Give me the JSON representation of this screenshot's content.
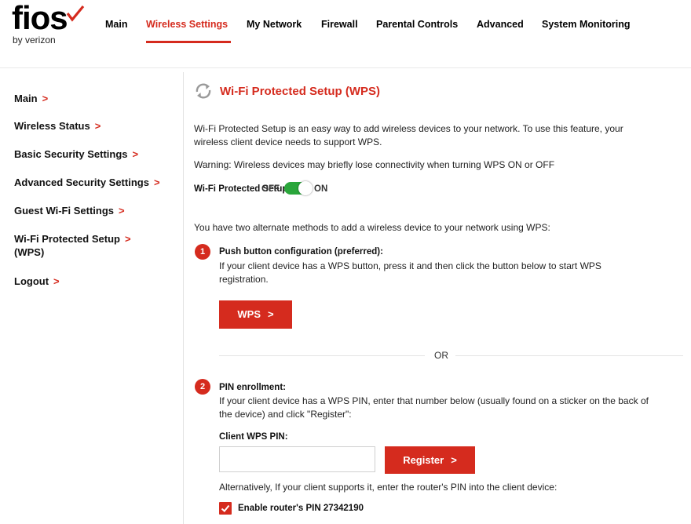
{
  "brand": {
    "logo": "fios",
    "sub": "by verizon",
    "accent": "#d52b1e"
  },
  "nav": {
    "main": "Main",
    "wireless": "Wireless Settings",
    "network": "My Network",
    "firewall": "Firewall",
    "parental": "Parental Controls",
    "advanced": "Advanced",
    "monitoring": "System Monitoring",
    "active": "Wireless Settings"
  },
  "sidebar": {
    "items": [
      {
        "label": "Main"
      },
      {
        "label": "Wireless Status"
      },
      {
        "label": "Basic Security Settings"
      },
      {
        "label": "Advanced Security Settings"
      },
      {
        "label": "Guest Wi-Fi Settings"
      },
      {
        "label_line1": "Wi-Fi Protected Setup",
        "label_line2": "(WPS)"
      },
      {
        "label": "Logout"
      }
    ]
  },
  "main": {
    "title": "Wi-Fi Protected Setup (WPS)",
    "intro_line1": "Wi-Fi Protected Setup is an easy way to add wireless devices to your network. To use this feature, your",
    "intro_line2": "wireless client device needs to support WPS.",
    "warning": "Warning: Wireless devices may briefly lose connectivity when turning WPS ON or OFF",
    "wps_label": "Wi-Fi Protected Setup:",
    "toggle_off": "OFF",
    "toggle_on": "ON",
    "toggle_state": "ON",
    "methods_text": "You have two alternate methods to add a wireless device to your network using WPS:",
    "method1": {
      "number": "1",
      "title": "Push button configuration (preferred):",
      "desc_line1": "If your client device has a WPS button, press it and then click the button below to start WPS",
      "desc_line2": "registration.",
      "button": "WPS"
    },
    "or_text": "OR",
    "method2": {
      "number": "2",
      "title": "PIN enrollment:",
      "desc_line1": "If your client device has a WPS PIN, enter that number below (usually found on a sticker on the back of",
      "desc_line2": "the device) and click \"Register\":",
      "pin_label": "Client WPS PIN:",
      "pin_value": "",
      "button": "Register"
    },
    "alt_text": "Alternatively, If your client supports it, enter the router's PIN into the client device:",
    "router_pin_label": "Enable router's PIN 27342190",
    "router_pin_checked": true
  }
}
